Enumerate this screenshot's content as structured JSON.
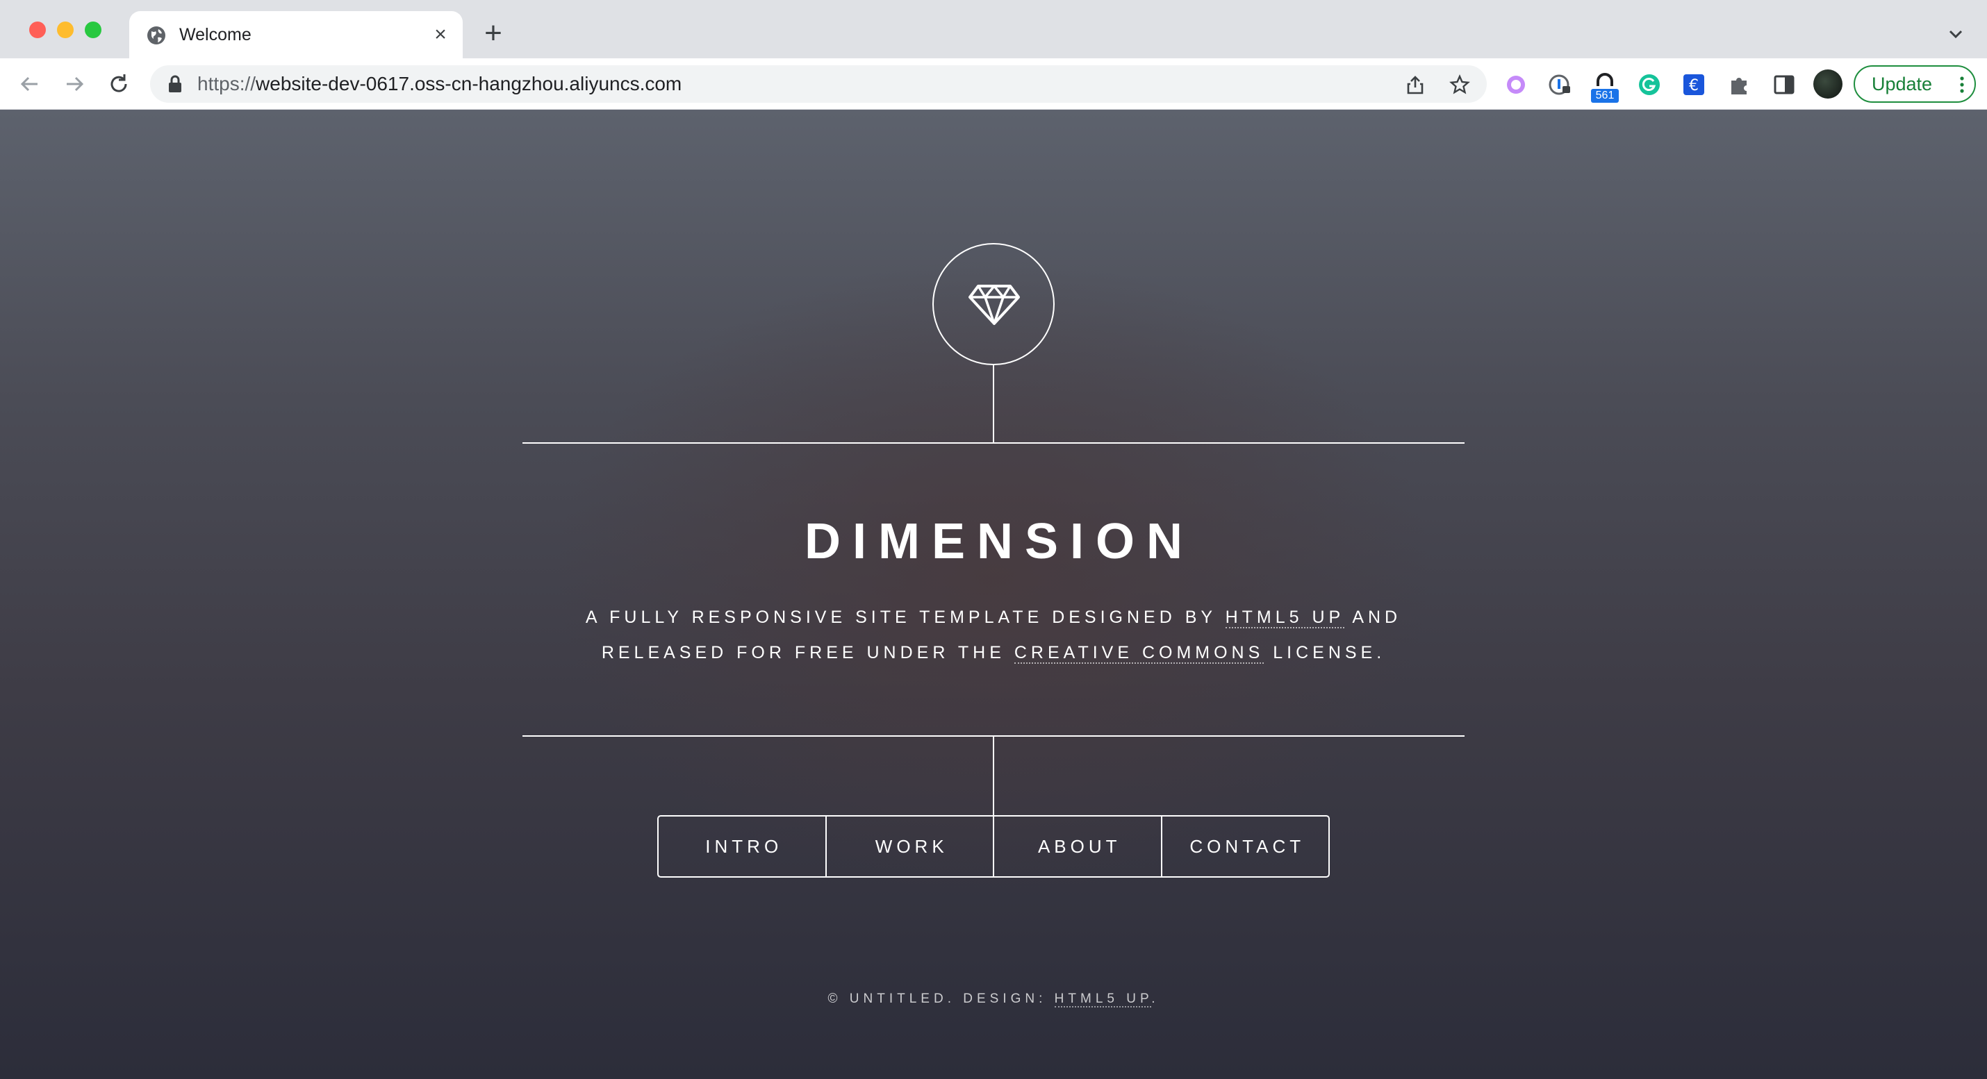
{
  "browser": {
    "tab_title": "Welcome",
    "url_scheme": "https://",
    "url_host": "website-dev-0617.oss-cn-hangzhou.aliyuncs.com",
    "update_label": "Update",
    "extension_badge": "561"
  },
  "hero": {
    "title": "DIMENSION",
    "subtitle_part1": "A fully responsive site template designed by ",
    "subtitle_link1": "HTML5 UP",
    "subtitle_part2": " and released for free under the ",
    "subtitle_link2": "Creative Commons",
    "subtitle_part3": " license."
  },
  "nav": {
    "items": [
      "INTRO",
      "WORK",
      "ABOUT",
      "CONTACT"
    ]
  },
  "footer": {
    "text": "© UNTITLED. DESIGN: ",
    "link": "HTML5 UP",
    "suffix": "."
  },
  "colors": {
    "accent_green": "#188038",
    "tab_bar": "#dfe1e5",
    "page_text": "#ffffff"
  }
}
